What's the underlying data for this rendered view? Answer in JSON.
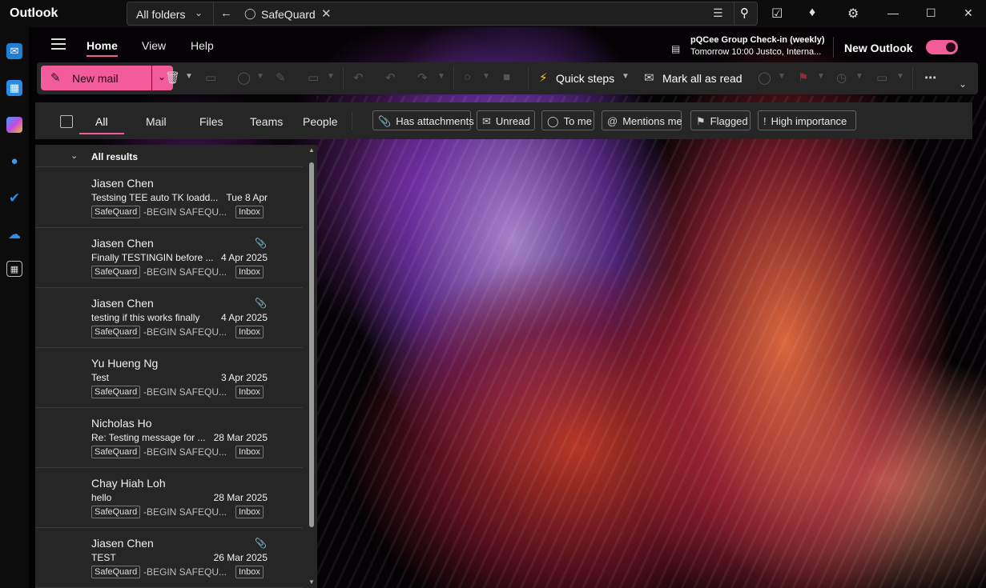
{
  "app": {
    "title": "Outlook"
  },
  "search": {
    "scope": "All folders",
    "query": "SafeQuard"
  },
  "nav": {
    "tabs": [
      {
        "label": "Home"
      },
      {
        "label": "View"
      },
      {
        "label": "Help"
      }
    ],
    "meeting": {
      "title": "pQCee Group Check-in (weekly)",
      "detail": "Tomorrow 10:00 Justco, Interna..."
    },
    "new_outlook": "New Outlook"
  },
  "ribbon": {
    "new_mail": "New mail",
    "quick_steps": "Quick steps",
    "mark_all_read": "Mark all as read"
  },
  "filters": {
    "tabs": [
      "All",
      "Mail",
      "Files",
      "Teams",
      "People"
    ],
    "chips": [
      "Has attachments",
      "Unread",
      "To me",
      "Mentions me",
      "Flagged",
      "High importance"
    ]
  },
  "list": {
    "header": "All results",
    "messages": [
      {
        "sender": "Jiasen Chen",
        "subject": "Testsing TEE auto TK loadd...",
        "date": "Tue 8 Apr",
        "tag": "SafeQuard",
        "preview": "-BEGIN SAFEQU...",
        "folder": "Inbox",
        "attachment": false
      },
      {
        "sender": "Jiasen Chen",
        "subject": "Finally TESTINGIN before ...",
        "date": "4 Apr 2025",
        "tag": "SafeQuard",
        "preview": "-BEGIN SAFEQU...",
        "folder": "Inbox",
        "attachment": true
      },
      {
        "sender": "Jiasen Chen",
        "subject": "testing if this works finally",
        "date": "4 Apr 2025",
        "tag": "SafeQuard",
        "preview": "-BEGIN SAFEQU...",
        "folder": "Inbox",
        "attachment": true
      },
      {
        "sender": "Yu Hueng Ng",
        "subject": "Test",
        "date": "3 Apr 2025",
        "tag": "SafeQuard",
        "preview": "-BEGIN SAFEQU...",
        "folder": "Inbox",
        "attachment": false
      },
      {
        "sender": "Nicholas Ho",
        "subject": "Re: Testing message for ...",
        "date": "28 Mar 2025",
        "tag": "SafeQuard",
        "preview": "-BEGIN SAFEQU...",
        "folder": "Inbox",
        "attachment": false
      },
      {
        "sender": "Chay Hiah Loh",
        "subject": "hello",
        "date": "28 Mar 2025",
        "tag": "SafeQuard",
        "preview": "-BEGIN SAFEQU...",
        "folder": "Inbox",
        "attachment": false
      },
      {
        "sender": "Jiasen Chen",
        "subject": "TEST",
        "date": "26 Mar 2025",
        "tag": "SafeQuard",
        "preview": "-BEGIN SAFEQU...",
        "folder": "Inbox",
        "attachment": true
      }
    ]
  },
  "colors": {
    "accent": "#f25c9a",
    "panel": "#262626",
    "titlebar": "#0c0c0c"
  }
}
